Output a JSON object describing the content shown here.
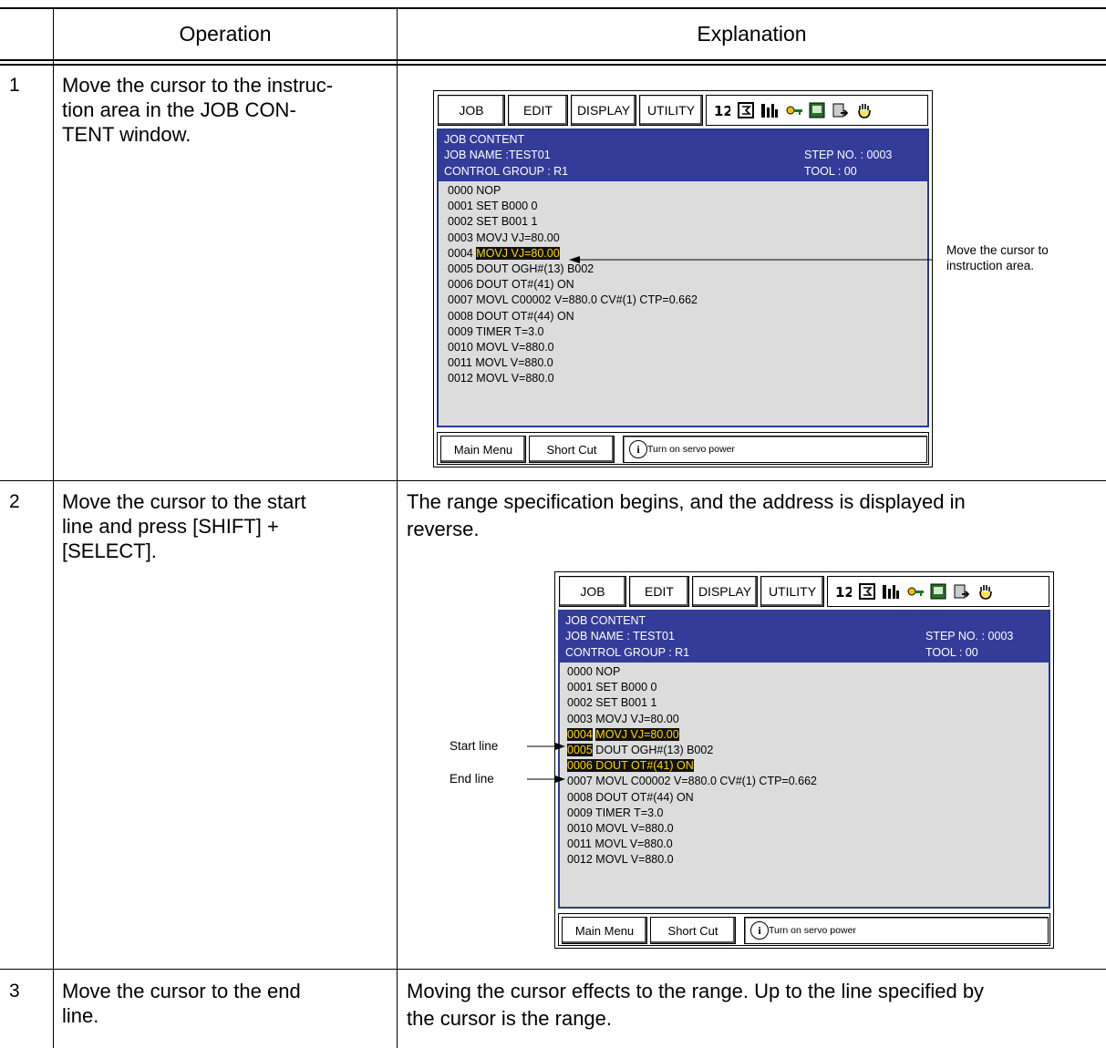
{
  "table": {
    "header_operation": "Operation",
    "header_explanation": "Explanation",
    "rows": [
      {
        "num": "1",
        "operation": "Move the cursor to the instruc-\ntion area in the JOB CON-\nTENT window.",
        "explanation": ""
      },
      {
        "num": "2",
        "operation": "Move the cursor to the start\nline and press [SHIFT] +\n[SELECT].",
        "explanation": "The range specification begins, and the address is displayed in\nreverse."
      },
      {
        "num": "3",
        "operation": "Move the cursor to the end\nline.",
        "explanation": "Moving the cursor effects to the range. Up to the line specified by\nthe cursor is the range."
      }
    ]
  },
  "screen1": {
    "menu": [
      "JOB",
      "EDIT",
      "DISPLAY",
      "UTILITY"
    ],
    "title": "JOB CONTENT",
    "job_name": "JOB NAME :TEST01",
    "control_group": "CONTROL GROUP : R1",
    "step_no": "STEP NO. : 0003",
    "tool": "TOOL  : 00",
    "lines": [
      "0000 NOP",
      "0001 SET B000 0",
      "0002 SET B001 1",
      "0003 MOVJ VJ=80.00",
      "0004 MOVJ VJ=80.00",
      "0005 DOUT OGH#(13) B002",
      "0006 DOUT OT#(41) ON",
      "0007 MOVL C00002 V=880.0 CV#(1) CTP=0.662",
      "0008 DOUT OT#(44) ON",
      "0009 TIMER T=3.0",
      "0010 MOVL V=880.0",
      "0011 MOVL V=880.0",
      "0012 MOVL V=880.0"
    ],
    "cursor_line_prefix": "0004 ",
    "cursor_line_body": "MOVJ VJ=80.00",
    "footer_main_menu": "Main Menu",
    "footer_short_cut": "Short Cut",
    "footer_message": "Turn on servo power",
    "annotation": "Move the cursor to\ninstruction area."
  },
  "screen2": {
    "menu": [
      "JOB",
      "EDIT",
      "DISPLAY",
      "UTILITY"
    ],
    "title": "JOB CONTENT",
    "job_name": "JOB NAME : TEST01",
    "control_group": "CONTROL GROUP : R1",
    "step_no": "STEP NO. : 0003",
    "tool": "TOOL : 00",
    "lines": [
      "0000 NOP",
      "0001 SET B000 0",
      "0002 SET B001 1",
      "0003 MOVJ VJ=80.00",
      "0004",
      "0005",
      "0006",
      "0007 MOVL C00002 V=880.0 CV#(1) CTP=0.662",
      "0008 DOUT OT#(44) ON",
      "0009 TIMER T=3.0",
      "0010 MOVL V=880.0",
      "0011 MOVL V=880.0",
      "0012 MOVL V=880.0"
    ],
    "line4_body": "MOVJ VJ=80.00",
    "line5_body": "DOUT OGH#(13) B002",
    "line6_body": "DOUT OT#(41) ON",
    "footer_main_menu": "Main Menu",
    "footer_short_cut": "Short Cut",
    "footer_message": "Turn on servo power",
    "start_label": "Start line",
    "end_label": "End line"
  },
  "colors": {
    "header_bar": "#333c99",
    "content_bg": "#dcdcdc",
    "highlight_text": "#ffd600",
    "highlight_bg": "#111111"
  },
  "icons": [
    "numbers-icon",
    "sigma-box-icon",
    "m-bars-icon",
    "keys-icon",
    "screen-icon",
    "doc-arrow-icon",
    "hand-icon"
  ]
}
